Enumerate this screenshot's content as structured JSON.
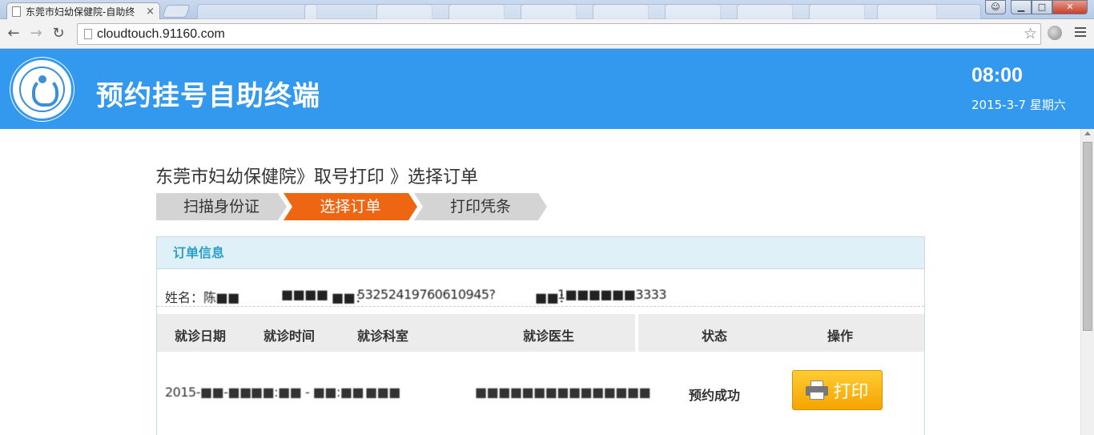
{
  "browser": {
    "active_tab_title": "东莞市妇幼保健院-自助终",
    "tab_close": "×",
    "url": "cloudtouch.91160.com",
    "window_min": "▁",
    "window_max": "□",
    "window_close": "✕",
    "back_icon": "←",
    "forward_icon": "→",
    "reload_icon": "↻",
    "star_icon": "☆"
  },
  "header": {
    "title": "预约挂号自助终端",
    "time": "08:00",
    "date": "2015-3-7 星期六",
    "color": "#3399ee"
  },
  "breadcrumb": "东莞市妇幼保健院》取号打印 》选择订单",
  "steps": [
    {
      "label": "扫描身份证",
      "active": false
    },
    {
      "label": "选择订单",
      "active": true
    },
    {
      "label": "打印凭条",
      "active": false
    }
  ],
  "panel": {
    "title": "订单信息",
    "patient": {
      "name_label": "姓名：",
      "name_value": "陈■■",
      "field2": "■■■■",
      "id_label": "■■：",
      "id_value": "53252419760610945?",
      "phone_label": "■■：",
      "phone_value": "1■■■■■■3333"
    },
    "table": {
      "columns": [
        "就诊日期",
        "就诊时间",
        "就诊科室",
        "就诊医生",
        "状态",
        "操作"
      ],
      "rows": [
        {
          "date": "2015-■■-■■",
          "time": "■■:■■ - ■■:■■",
          "dept": "■■■",
          "doctor": "■■■■■■■■■■■■■■■",
          "status": "预约成功",
          "action": "打印"
        }
      ]
    }
  },
  "colors": {
    "active_step": "#ee6611",
    "status_success": "#dd1111",
    "print_button": "#f5a400"
  }
}
